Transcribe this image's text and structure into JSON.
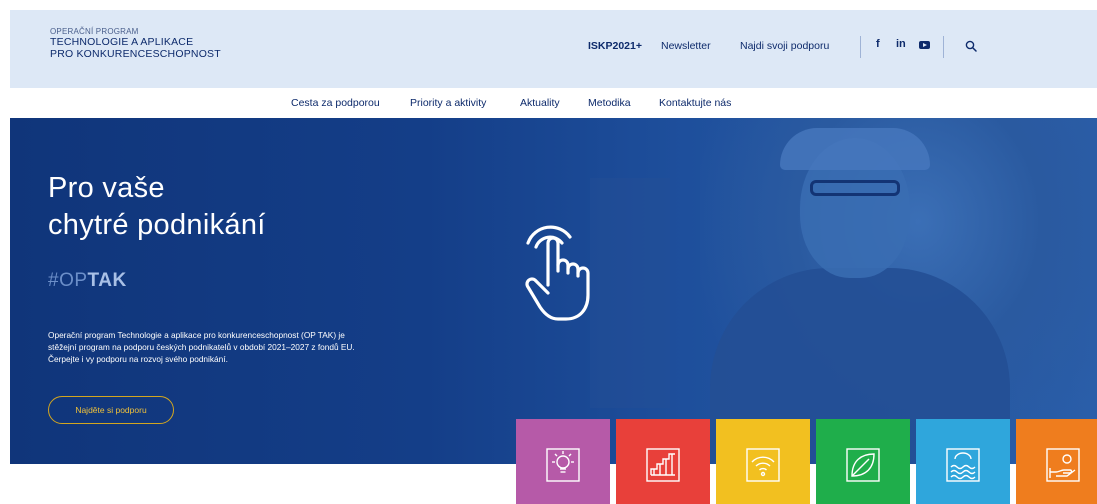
{
  "header": {
    "logo": {
      "line1": "OPERAČNÍ PROGRAM",
      "line2": "TECHNOLOGIE A APLIKACE",
      "line3": "PRO KONKURENCESCHOPNOST"
    },
    "links": [
      {
        "label": "ISKP2021+"
      },
      {
        "label": "Newsletter"
      },
      {
        "label": "Najdi svoji podporu"
      }
    ],
    "social": [
      {
        "icon": "facebook-icon",
        "glyph": "f"
      },
      {
        "icon": "linkedin-icon",
        "glyph": "in"
      },
      {
        "icon": "youtube-icon"
      }
    ],
    "search_icon": "search-icon"
  },
  "nav": {
    "items": [
      {
        "label": "Cesta za podporou"
      },
      {
        "label": "Priority a aktivity"
      },
      {
        "label": "Aktuality"
      },
      {
        "label": "Metodika"
      },
      {
        "label": "Kontaktujte nás"
      }
    ]
  },
  "hero": {
    "title_line1": "Pro vaše",
    "title_line2": "chytré podnikání",
    "hashtag_prefix": "#OP",
    "hashtag_bold": "TAK",
    "lead_line1": "Operační program Technologie a aplikace pro konkurenceschopnost (OP TAK) je",
    "lead_line2": "stěžejní program na podporu českých podnikatelů v období 2021–2027 z fondů EU.",
    "lead_line3": "Čerpejte i vy podporu na rozvoj svého podnikání.",
    "cta_label": "Najděte si podporu",
    "overlay_icon": "tap-hand-icon"
  },
  "tiles": [
    {
      "icon": "lightbulb-icon",
      "color": "#b65aa8"
    },
    {
      "icon": "growth-chart-icon",
      "color": "#e8403a"
    },
    {
      "icon": "wifi-signal-icon",
      "color": "#f2c020"
    },
    {
      "icon": "leaf-icon",
      "color": "#1fae4b"
    },
    {
      "icon": "water-waves-icon",
      "color": "#2fa6dc"
    },
    {
      "icon": "hand-coin-icon",
      "color": "#ef7d1e"
    }
  ],
  "colors": {
    "header_bg": "#dde8f6",
    "navy": "#0d2a6b",
    "hero_bg": "#143e88",
    "cta_gold": "#f0c23a"
  }
}
